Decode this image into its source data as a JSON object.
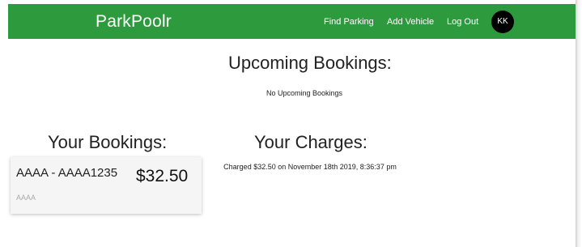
{
  "nav": {
    "brand": "ParkPoolr",
    "links": [
      "Find Parking",
      "Add Vehicle",
      "Log Out"
    ],
    "avatar_initials": "KK",
    "accent": "#2e9a3e"
  },
  "upcoming": {
    "title": "Upcoming Bookings:",
    "empty_text": "No Upcoming Bookings"
  },
  "bookings": {
    "title": "Your Bookings:",
    "items": [
      {
        "name": "AAAA - AAAA1235",
        "price": "$32.50",
        "subtitle": "AAAA"
      }
    ]
  },
  "charges": {
    "title": "Your Charges:",
    "items": [
      "Charged $32.50 on November 18th 2019, 8:36:37 pm"
    ]
  }
}
